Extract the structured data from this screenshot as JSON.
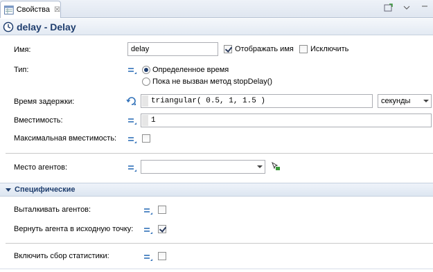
{
  "tab": {
    "label": "Свойства",
    "close": "☒"
  },
  "header": {
    "title": "delay - Delay"
  },
  "name_row": {
    "label": "Имя:",
    "value": "delay",
    "show_name_label": "Отображать имя",
    "show_name_checked": true,
    "exclude_label": "Исключить",
    "exclude_checked": false
  },
  "type_row": {
    "label": "Тип:",
    "options": [
      "Определенное время",
      "Пока не вызван метод stopDelay()"
    ],
    "selected": 0
  },
  "delay_row": {
    "label": "Время задержки:",
    "value": "triangular( 0.5, 1, 1.5 )",
    "unit": "секунды"
  },
  "capacity_row": {
    "label": "Вместимость:",
    "value": "1"
  },
  "max_capacity_row": {
    "label": "Максимальная вместимость:",
    "checked": false
  },
  "agent_location_row": {
    "label": "Место агентов:",
    "value": ""
  },
  "specific_section": {
    "title": "Специфические"
  },
  "push_agents_row": {
    "label": "Выталкивать агентов:",
    "checked": false
  },
  "return_agent_row": {
    "label": "Вернуть агента в исходную точку:",
    "checked": true
  },
  "stats_row": {
    "label": "Включить сбор статистики:",
    "checked": false
  }
}
